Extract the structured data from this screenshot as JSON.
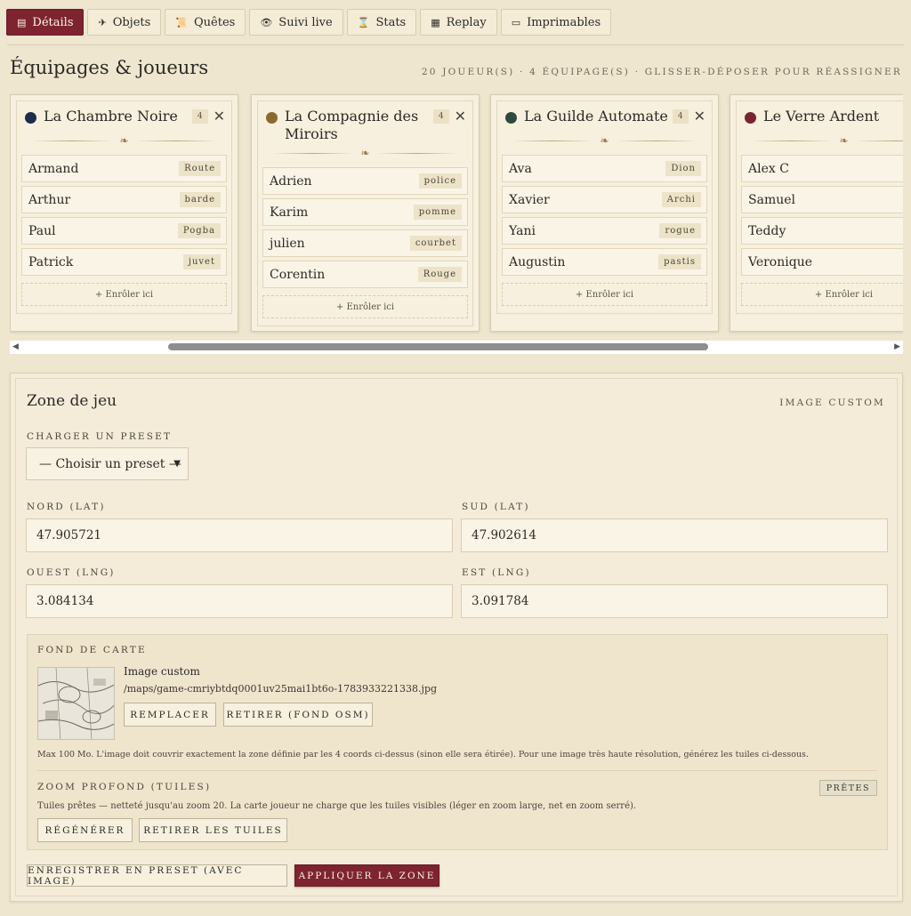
{
  "tabs": [
    {
      "label": "Détails",
      "icon": "chest-icon",
      "glyph": "▤",
      "active": true
    },
    {
      "label": "Objets",
      "icon": "map-icon",
      "glyph": "✈",
      "active": false
    },
    {
      "label": "Quêtes",
      "icon": "scroll-icon",
      "glyph": "📜",
      "active": false
    },
    {
      "label": "Suivi live",
      "icon": "eye-icon",
      "glyph": "👁",
      "active": false
    },
    {
      "label": "Stats",
      "icon": "hourglass-icon",
      "glyph": "⌛",
      "active": false
    },
    {
      "label": "Replay",
      "icon": "clapper-icon",
      "glyph": "▦",
      "active": false
    },
    {
      "label": "Imprimables",
      "icon": "printer-icon",
      "glyph": "▭",
      "active": false
    }
  ],
  "section": {
    "title": "Équipages & joueurs",
    "meta": "20 joueur(s) · 4 équipage(s) · glisser-déposer pour réassigner"
  },
  "teams": [
    {
      "name": "La Chambre Noire",
      "color": "#1f2d4d",
      "count": "4",
      "players": [
        {
          "name": "Armand",
          "tag": "Route"
        },
        {
          "name": "Arthur",
          "tag": "barde"
        },
        {
          "name": "Paul",
          "tag": "Pogba"
        },
        {
          "name": "Patrick",
          "tag": "juvet"
        }
      ],
      "enrol": "+ Enrôler ici"
    },
    {
      "name": "La Compagnie des Miroirs",
      "color": "#8a6a2e",
      "count": "4",
      "players": [
        {
          "name": "Adrien",
          "tag": "police"
        },
        {
          "name": "Karim",
          "tag": "pomme"
        },
        {
          "name": "julien",
          "tag": "courbet"
        },
        {
          "name": "Corentin",
          "tag": "Rouge"
        }
      ],
      "enrol": "+ Enrôler ici"
    },
    {
      "name": "La Guilde Automate",
      "color": "#2e4a3c",
      "count": "4",
      "players": [
        {
          "name": "Ava",
          "tag": "Dion"
        },
        {
          "name": "Xavier",
          "tag": "Archi"
        },
        {
          "name": "Yani",
          "tag": "rogue"
        },
        {
          "name": "Augustin",
          "tag": "pastis"
        }
      ],
      "enrol": "+ Enrôler ici"
    },
    {
      "name": "Le Verre Ardent",
      "color": "#7a2430",
      "count": "",
      "players": [
        {
          "name": "Alex C",
          "tag": ""
        },
        {
          "name": "Samuel",
          "tag": ""
        },
        {
          "name": "Teddy",
          "tag": ""
        },
        {
          "name": "Veronique",
          "tag": ""
        }
      ],
      "enrol": "+ Enrôler ici"
    }
  ],
  "zone": {
    "title": "Zone de jeu",
    "tag": "Image custom",
    "preset_label": "Charger un preset",
    "preset_value": "— Choisir un preset —",
    "nord_label": "Nord (lat)",
    "nord": "47.905721",
    "sud_label": "Sud (lat)",
    "sud": "47.902614",
    "ouest_label": "Ouest (lng)",
    "ouest": "3.084134",
    "est_label": "Est (lng)",
    "est": "3.091784",
    "fond_label": "Fond de carte",
    "img_title": "Image custom",
    "img_path": "/maps/game-cmriybtdq0001uv25mai1bt6o-1783933221338.jpg",
    "btn_replace": "Remplacer",
    "btn_remove": "Retirer (fond OSM)",
    "hint": "Max 100 Mo. L'image doit couvrir exactement la zone définie par les 4 coords ci-dessus (sinon elle sera étirée). Pour une image très haute résolution, générez les tuiles ci-dessous.",
    "zoom_label": "Zoom profond (tuiles)",
    "zoom_badge": "Prêtes",
    "zoom_text": "Tuiles prêtes — netteté jusqu'au zoom 20. La carte joueur ne charge que les tuiles visibles (léger en zoom large, net en zoom serré).",
    "btn_regen": "Régénérer",
    "btn_tiles_remove": "Retirer les tuiles",
    "btn_save_preset": "Enregistrer en preset (avec image)",
    "btn_apply": "Appliquer la zone"
  }
}
